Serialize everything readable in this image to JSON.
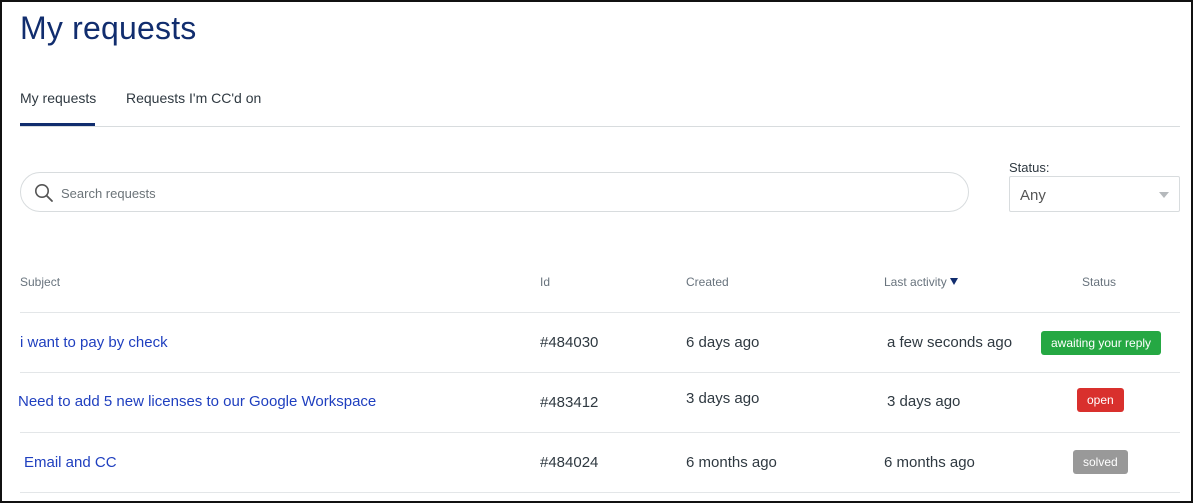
{
  "page": {
    "title": "My requests"
  },
  "tabs": [
    {
      "label": "My requests",
      "active": true
    },
    {
      "label": "Requests I'm CC'd on",
      "active": false
    }
  ],
  "search": {
    "placeholder": "Search requests",
    "value": ""
  },
  "status_filter": {
    "label": "Status:",
    "selected": "Any"
  },
  "table": {
    "headers": {
      "subject": "Subject",
      "id": "Id",
      "created": "Created",
      "last_activity": "Last activity",
      "status": "Status"
    },
    "sort": {
      "column": "last_activity",
      "direction": "descending"
    },
    "rows": [
      {
        "subject": "i want to pay by check",
        "id": "#484030",
        "created": "6 days ago",
        "last_activity": "a few seconds ago",
        "status": "awaiting your reply",
        "status_color": "#25a843"
      },
      {
        "subject": "Need to add 5 new licenses to our Google Workspace",
        "id": "#483412",
        "created": "3 days ago",
        "last_activity": "3 days ago",
        "status": "open",
        "status_color": "#d9302d"
      },
      {
        "subject": "Email and CC",
        "id": "#484024",
        "created": "6 months ago",
        "last_activity": "6 months ago",
        "status": "solved",
        "status_color": "#999999"
      }
    ]
  },
  "colors": {
    "accent": "#112d6e",
    "link": "#1f3fbf"
  }
}
